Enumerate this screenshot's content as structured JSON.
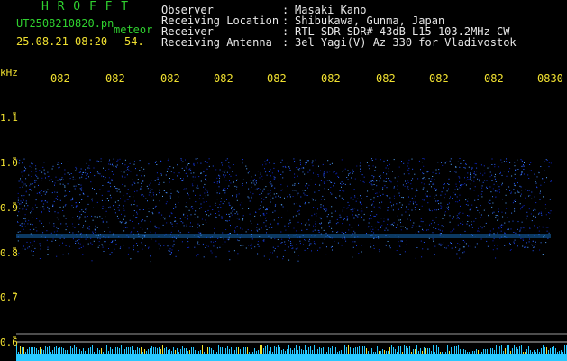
{
  "header": {
    "title": "H R O F F T",
    "filename": "UT2508210820.pn",
    "meteor_label": "meteor",
    "datetime": "25.08.21 08:20",
    "count": "54.",
    "fields": [
      {
        "label": "Observer",
        "value": "Masaki Kano"
      },
      {
        "label": "Receiving Location",
        "value": "Shibukawa, Gunma, Japan"
      },
      {
        "label": "Receiver",
        "value": "RTL-SDR SDR# 43dB L15 103.2MHz CW"
      },
      {
        "label": "Receiving Antenna",
        "value": "3el Yagi(V) Az 330 for Vladivostok"
      }
    ],
    "colon": ":"
  },
  "axes": {
    "freq_unit": "kHz",
    "time_ticks": [
      "082",
      "082",
      "082",
      "082",
      "082",
      "082",
      "082",
      "082",
      "082",
      "0830"
    ],
    "freq_ticks": [
      "1.1",
      "1.0",
      "0.9",
      "0.8",
      "0.7",
      "0.6"
    ]
  },
  "colors": {
    "text_green": "#2fd12f",
    "text_white": "#e8e8e8",
    "axis_yellow": "#f0e030",
    "signal_cyan": "#33e0ff",
    "noise_blue": "#1a3cff"
  }
}
